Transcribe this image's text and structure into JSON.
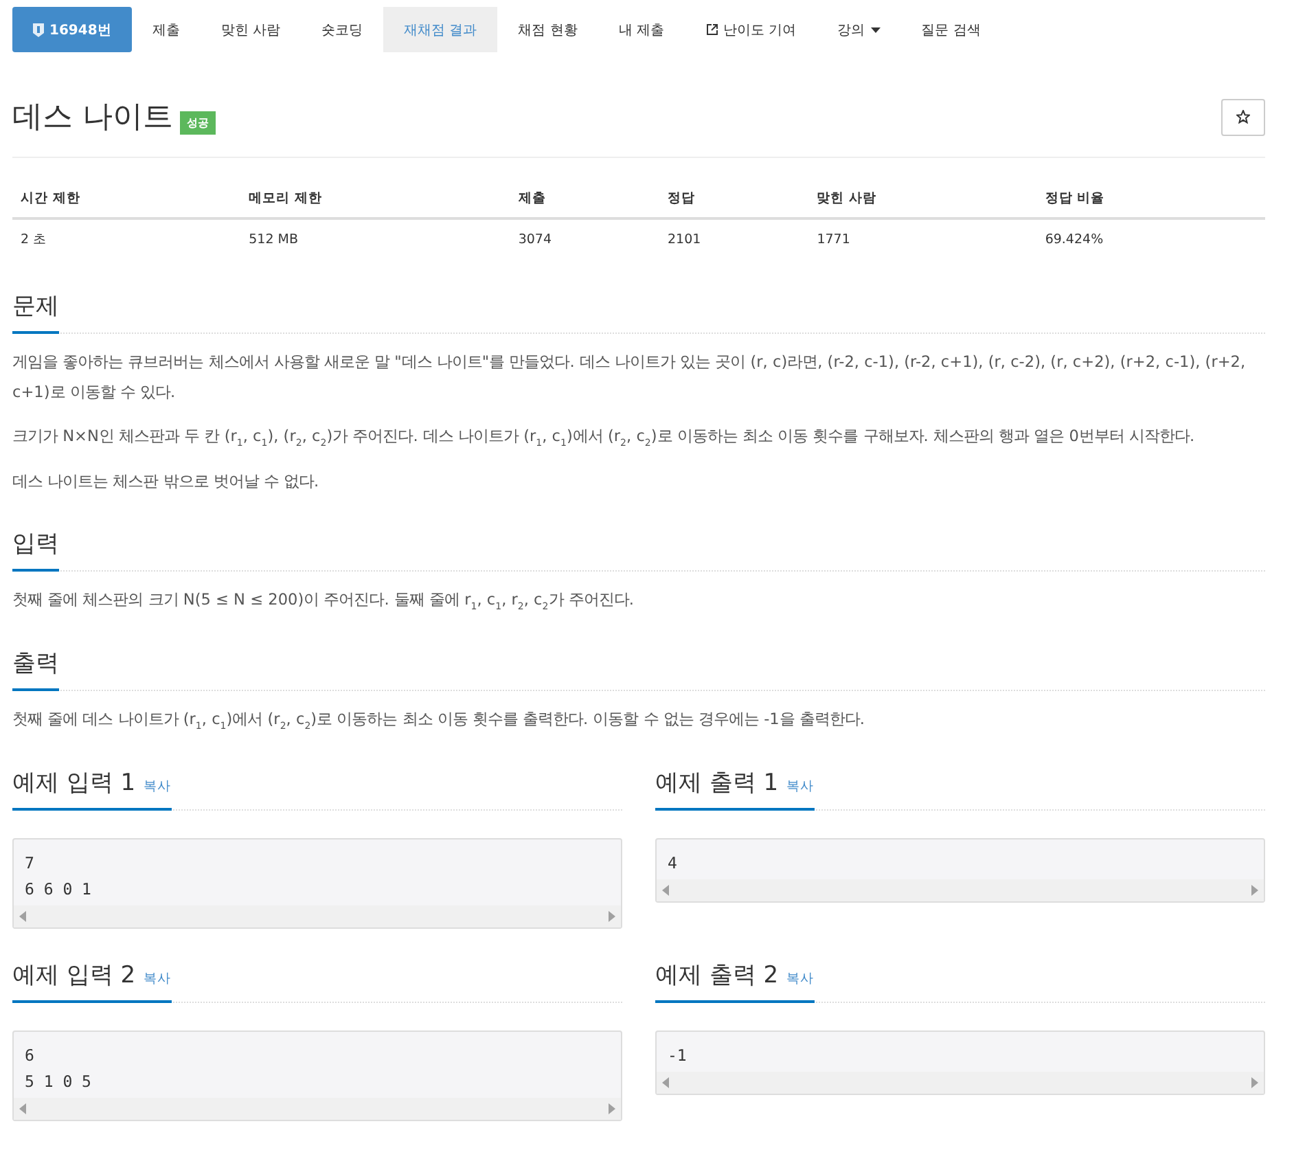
{
  "nav": [
    {
      "label": "16948번",
      "kind": "id",
      "selected": false
    },
    {
      "label": "제출",
      "kind": "plain",
      "selected": false
    },
    {
      "label": "맞힌 사람",
      "kind": "plain",
      "selected": false
    },
    {
      "label": "숏코딩",
      "kind": "plain",
      "selected": false
    },
    {
      "label": "재채점 결과",
      "kind": "plain",
      "selected": true
    },
    {
      "label": "채점 현황",
      "kind": "plain",
      "selected": false
    },
    {
      "label": "내 제출",
      "kind": "plain",
      "selected": false
    },
    {
      "label": "난이도 기여",
      "kind": "external",
      "selected": false
    },
    {
      "label": "강의",
      "kind": "dropdown",
      "selected": false
    },
    {
      "label": "질문 검색",
      "kind": "plain",
      "selected": false
    }
  ],
  "title": "데스 나이트",
  "status_badge": "성공",
  "info_table": {
    "columns": [
      "시간 제한",
      "메모리 제한",
      "제출",
      "정답",
      "맞힌 사람",
      "정답 비율"
    ],
    "rows": [
      [
        "2 초",
        "512 MB",
        "3074",
        "2101",
        "1771",
        "69.424%"
      ]
    ]
  },
  "sections": [
    {
      "heading": "문제",
      "paragraphs": [
        "게임을 좋아하는 큐브러버는 체스에서 사용할 새로운 말 \"데스 나이트\"를 만들었다. 데스 나이트가 있는 곳이 (r, c)라면, (r-2, c-1), (r-2, c+1), (r, c-2), (r, c+2), (r+2, c-1), (r+2, c+1)로 이동할 수 있다.",
        "크기가 N×N인 체스판과 두 칸 (r$_{1}$, c$_{1}$), (r$_{2}$, c$_{2}$)가 주어진다. 데스 나이트가 (r$_{1}$, c$_{1}$)에서 (r$_{2}$, c$_{2}$)로 이동하는 최소 이동 횟수를 구해보자. 체스판의 행과 열은 0번부터 시작한다.",
        "데스 나이트는 체스판 밖으로 벗어날 수 없다."
      ]
    },
    {
      "heading": "입력",
      "paragraphs": [
        "첫째 줄에 체스판의 크기 N(5 ≤ N ≤ 200)이 주어진다. 둘째 줄에 r$_{1}$, c$_{1}$, r$_{2}$, c$_{2}$가 주어진다."
      ]
    },
    {
      "heading": "출력",
      "paragraphs": [
        "첫째 줄에 데스 나이트가 (r$_{1}$, c$_{1}$)에서 (r$_{2}$, c$_{2}$)로 이동하는 최소 이동 횟수를 출력한다. 이동할 수 없는 경우에는 -1을 출력한다."
      ]
    }
  ],
  "examples": [
    {
      "input": {
        "heading": "예제 입력 1",
        "copy": "복사",
        "lines": [
          "7",
          "6 6 0 1"
        ]
      },
      "output": {
        "heading": "예제 출력 1",
        "copy": "복사",
        "lines": [
          "4"
        ]
      }
    },
    {
      "input": {
        "heading": "예제 입력 2",
        "copy": "복사",
        "lines": [
          "6",
          "5 1 0 5"
        ]
      },
      "output": {
        "heading": "예제 출력 2",
        "copy": "복사",
        "lines": [
          "-1"
        ]
      }
    }
  ]
}
